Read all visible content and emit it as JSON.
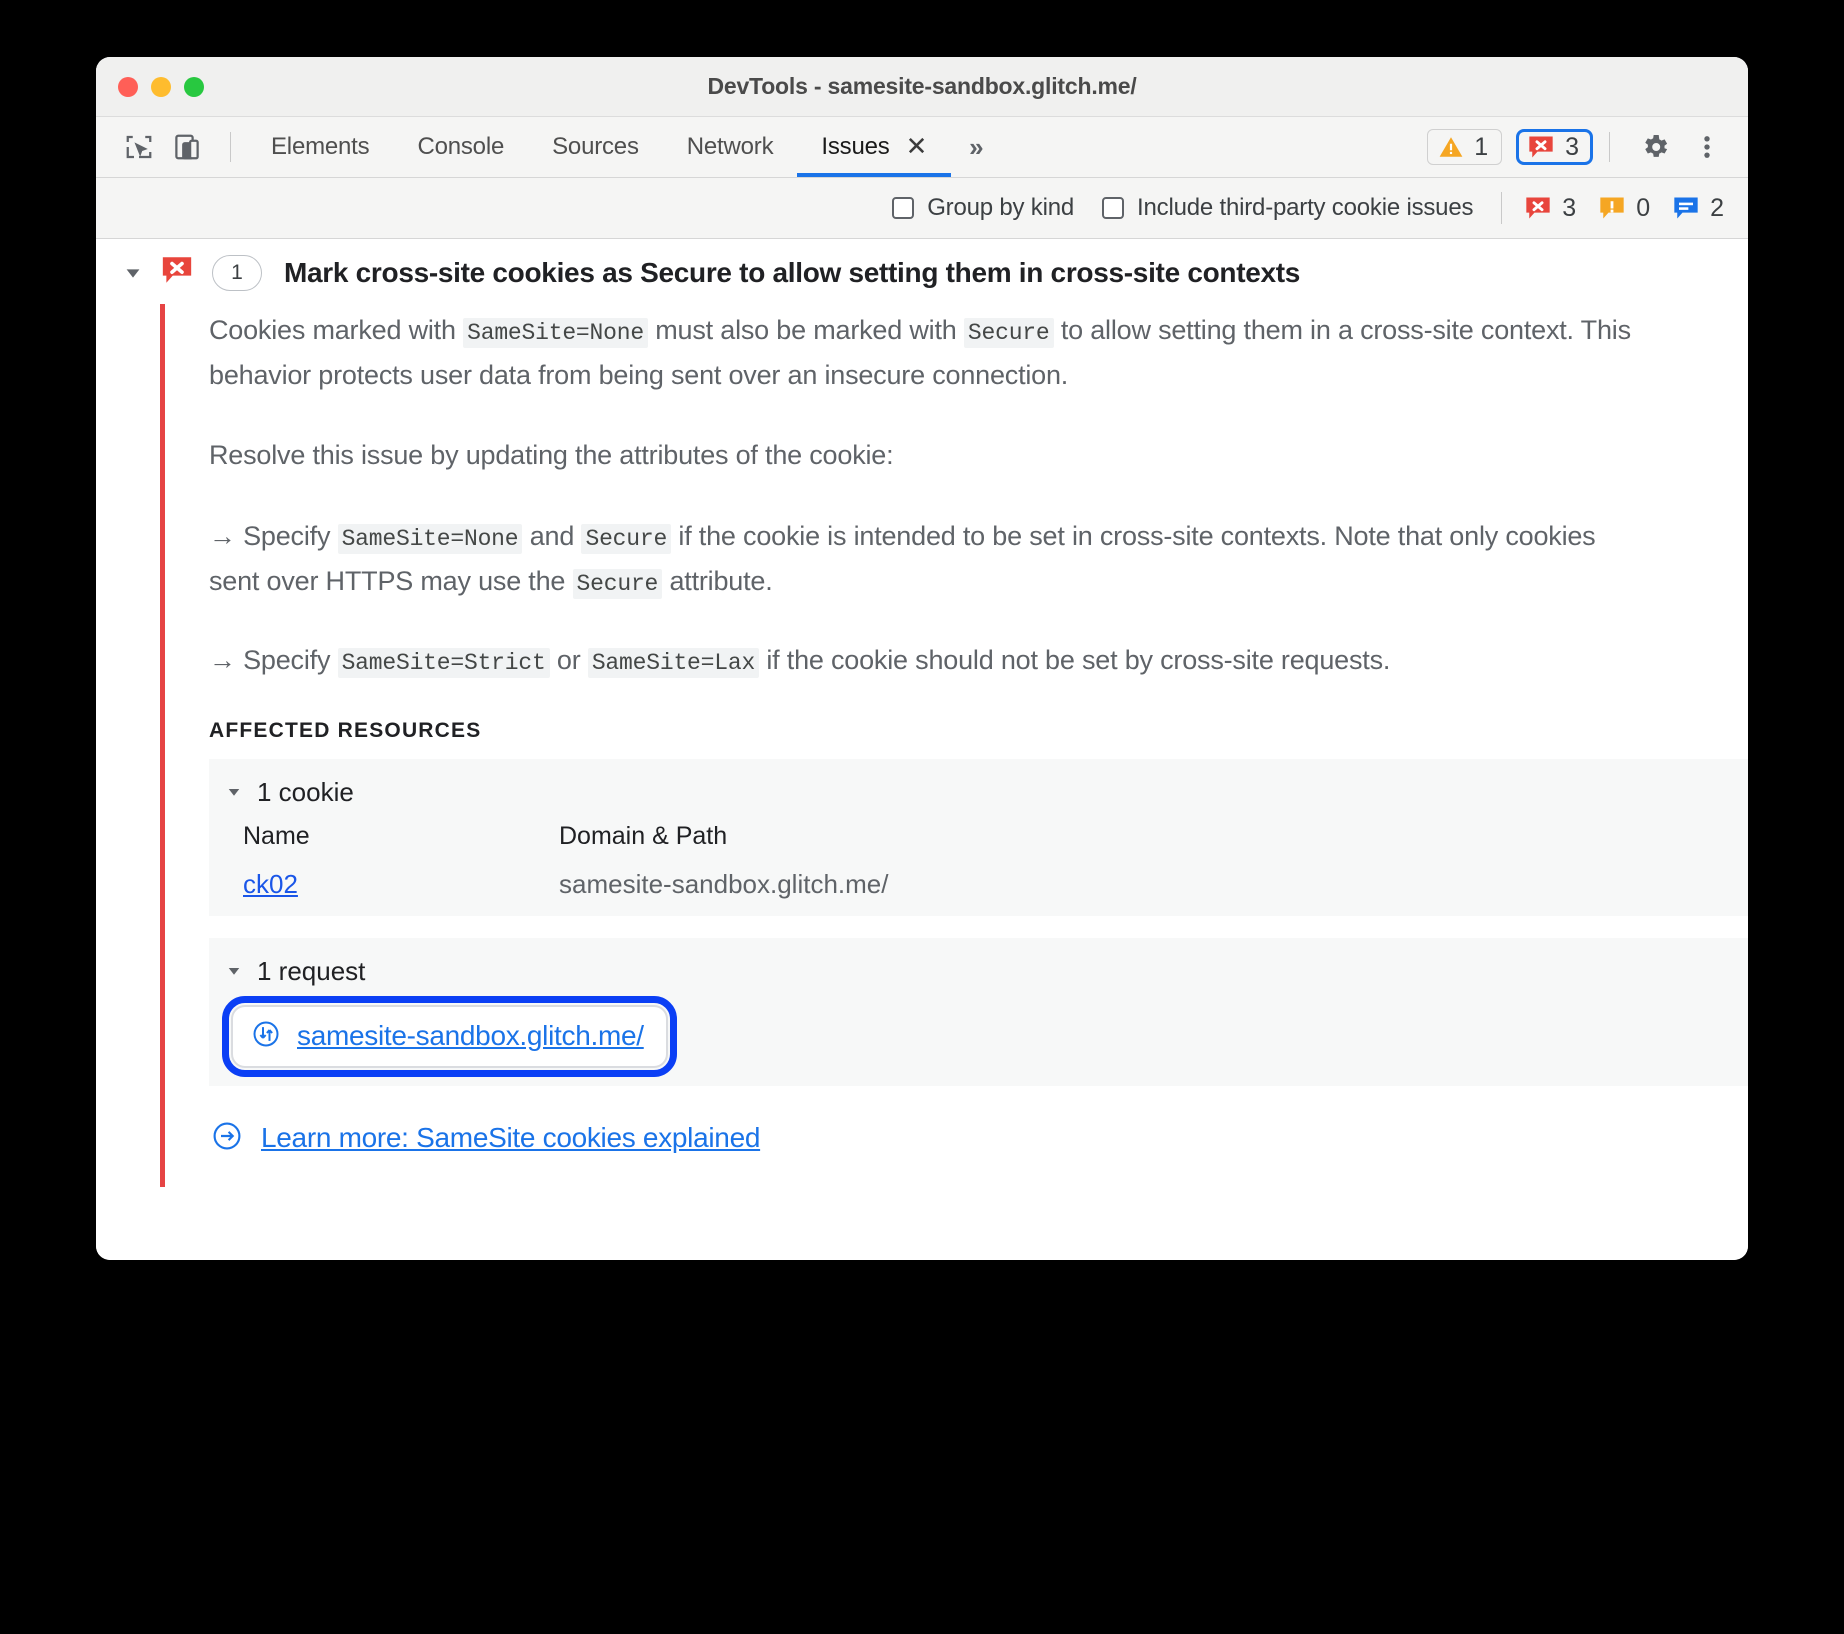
{
  "window": {
    "title": "DevTools - samesite-sandbox.glitch.me/",
    "traffic_lights": [
      "close",
      "minimize",
      "zoom"
    ]
  },
  "toolbar": {
    "inspect_icon": "inspect-element-icon",
    "device_icon": "device-toolbar-icon",
    "tabs": [
      {
        "label": "Elements",
        "active": false
      },
      {
        "label": "Console",
        "active": false
      },
      {
        "label": "Sources",
        "active": false
      },
      {
        "label": "Network",
        "active": false
      },
      {
        "label": "Issues",
        "active": true,
        "closable": true
      }
    ],
    "more_tabs_label": "»",
    "close_glyph": "✕",
    "warning_count": "1",
    "error_count": "3",
    "settings_icon": "gear-icon",
    "menu_icon": "more-vertical-icon"
  },
  "filters": {
    "group_by_kind": {
      "label": "Group by kind",
      "checked": false
    },
    "include_third_party": {
      "label": "Include third-party cookie issues",
      "checked": false
    },
    "stats": {
      "errors": "3",
      "warnings": "0",
      "info": "2"
    }
  },
  "issue": {
    "expanded": true,
    "severity_icon": "error-icon",
    "count": "1",
    "title": "Mark cross-site cookies as Secure to allow setting them in cross-site contexts",
    "paragraph1": {
      "seg1": "Cookies marked with ",
      "code1": "SameSite=None",
      "seg2": " must also be marked with ",
      "code2": "Secure",
      "seg3": " to allow setting them in a cross-site context. This behavior protects user data from being sent over an insecure connection."
    },
    "paragraph2": "Resolve this issue by updating the attributes of the cookie:",
    "bullet1": {
      "arrow": "→",
      "seg1": " Specify ",
      "code1": "SameSite=None",
      "seg2": " and ",
      "code2": "Secure",
      "seg3": " if the cookie is intended to be set in cross-site contexts. Note that only cookies sent over HTTPS may use the ",
      "code3": "Secure",
      "seg4": " attribute."
    },
    "bullet2": {
      "arrow": "→",
      "seg1": " Specify ",
      "code1": "SameSite=Strict",
      "seg2": " or ",
      "code2": "SameSite=Lax",
      "seg3": " if the cookie should not be set by cross-site requests."
    },
    "affected_resources_label": "AFFECTED RESOURCES",
    "cookies_section": {
      "summary": "1 cookie",
      "expanded": true,
      "columns": [
        "Name",
        "Domain & Path"
      ],
      "rows": [
        {
          "name": "ck02",
          "domain_path": "samesite-sandbox.glitch.me/"
        }
      ]
    },
    "requests_section": {
      "summary": "1 request",
      "expanded": true,
      "request_icon": "network-request-icon",
      "rows": [
        {
          "url": "samesite-sandbox.glitch.me/",
          "highlighted": true
        }
      ]
    },
    "learn_more": {
      "icon": "arrow-circle-right-icon",
      "label": "Learn more: SameSite cookies explained"
    }
  },
  "colors": {
    "error_red": "#e64444",
    "warning_orange": "#f5a623",
    "info_blue": "#1a73e8",
    "link_blue": "#1a73e8",
    "focus_ring": "#0b3ff5",
    "accent_tab": "#1a73e8"
  }
}
